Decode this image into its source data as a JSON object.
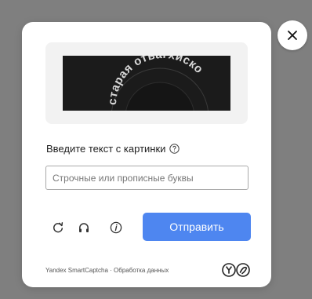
{
  "captcha": {
    "distorted_text": "старая отвагхиско"
  },
  "form": {
    "prompt": "Введите текст с картинки",
    "input_placeholder": "Строчные или прописные буквы",
    "input_value": ""
  },
  "actions": {
    "submit_label": "Отправить"
  },
  "footer": {
    "brand": "Yandex SmartCaptcha",
    "separator": " · ",
    "data_processing": "Обработка данных"
  },
  "icons": {
    "close": "close-icon",
    "help": "question-circle-icon",
    "refresh": "refresh-icon",
    "audio": "headphones-icon",
    "info": "info-icon",
    "logo": "yandex-smartcaptcha-logo"
  },
  "colors": {
    "accent": "#4e86f0",
    "overlay": "#7f7f7f",
    "captcha_bg": "#1b1b1b"
  }
}
